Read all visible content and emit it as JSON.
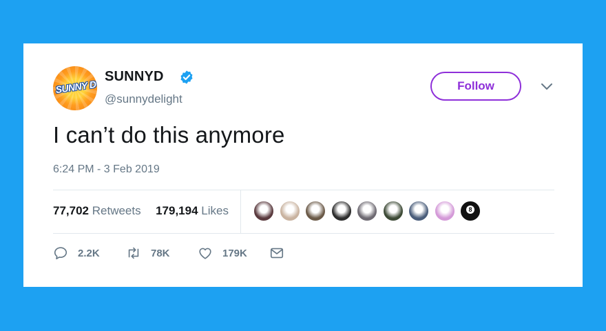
{
  "account": {
    "avatar_text": "SUNNY D",
    "name": "SUNNYD",
    "handle": "@sunnydelight",
    "verified": true
  },
  "follow_label": "Follow",
  "tweet": {
    "text": "I can’t do this anymore",
    "timestamp": "6:24 PM - 3 Feb 2019"
  },
  "stats": {
    "retweets_count": "77,702",
    "retweets_label": "Retweets",
    "likes_count": "179,194",
    "likes_label": "Likes"
  },
  "likers": [
    {
      "name": "liker-avatar-1",
      "color": "#5a3a3e"
    },
    {
      "name": "liker-avatar-2",
      "color": "#c9b3a0"
    },
    {
      "name": "liker-avatar-3",
      "color": "#6b5a48"
    },
    {
      "name": "liker-avatar-4",
      "color": "#2e2e2e"
    },
    {
      "name": "liker-avatar-5",
      "color": "#6e6a72"
    },
    {
      "name": "liker-avatar-6",
      "color": "#3d4a36"
    },
    {
      "name": "liker-avatar-7",
      "color": "#4a5d7a"
    },
    {
      "name": "liker-avatar-8",
      "color": "#d49ad8"
    },
    {
      "name": "liker-avatar-9",
      "color": "#111111"
    }
  ],
  "actions": {
    "reply_count": "2.2K",
    "retweet_count": "78K",
    "like_count": "179K"
  },
  "colors": {
    "background": "#1DA1F2",
    "follow_accent": "#8e2fd9",
    "verified_badge": "#1DA1F2",
    "muted_text": "#657786"
  }
}
